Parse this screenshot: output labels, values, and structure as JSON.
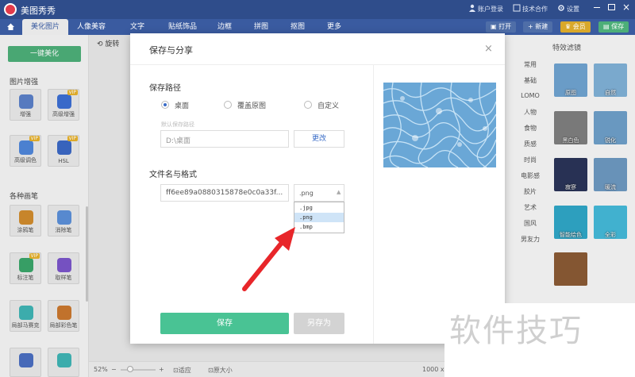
{
  "app": {
    "name": "美图秀秀"
  },
  "titlebar": {
    "account": "账户登录",
    "tech": "技术合作",
    "settings": "设置"
  },
  "tabs": [
    {
      "label": "美化图片",
      "active": true
    },
    {
      "label": "人像美容"
    },
    {
      "label": "文字"
    },
    {
      "label": "贴纸饰品"
    },
    {
      "label": "边框"
    },
    {
      "label": "拼图"
    },
    {
      "label": "抠图"
    },
    {
      "label": "更多"
    }
  ],
  "toolbar": {
    "open": "打开",
    "new": "新建",
    "crown": "会员",
    "save": "保存"
  },
  "left": {
    "one_click": "一键美化",
    "section_enhance": "图片增强",
    "section_brush": "各种画笔",
    "tools": [
      {
        "label": "增强",
        "vip": false,
        "color": "#5a7fc7"
      },
      {
        "label": "高级增强",
        "vip": true,
        "color": "#3c6ed2"
      },
      {
        "label": "高级调色",
        "vip": true,
        "color": "#4f86d9"
      },
      {
        "label": "HSL",
        "vip": false,
        "color": "#3b68c4"
      },
      {
        "label": "涂鸦笔",
        "vip": false,
        "color": "#d08b2d"
      },
      {
        "label": "消除笔",
        "vip": false,
        "color": "#5b8fd8"
      },
      {
        "label": "标注笔",
        "vip": true,
        "color": "#3aa56a"
      },
      {
        "label": "取样笔",
        "vip": false,
        "color": "#7a55c9"
      },
      {
        "label": "局部马赛克",
        "vip": false,
        "color": "#3fb3b3"
      },
      {
        "label": "局部彩色笔",
        "vip": false,
        "color": "#c9772e"
      }
    ],
    "vip_tag": "VIP"
  },
  "canvas": {
    "rotate": "旋转"
  },
  "bottom": {
    "zoom": "52%",
    "minus": "−",
    "plus": "+",
    "fit": "适应",
    "original": "原大小",
    "size": "1000 x"
  },
  "effects": {
    "title": "特效滤镜",
    "categories": [
      "常用",
      "基础",
      "LOMO",
      "人物",
      "食物",
      "质感",
      "时尚",
      "电影感",
      "胶片",
      "艺术",
      "国风",
      "男友力"
    ],
    "items": [
      {
        "label": "原图",
        "color": "#6fa3d0"
      },
      {
        "label": "自然",
        "color": "#7fb0d6"
      },
      {
        "label": "黑白色",
        "color": "#7e7e7e"
      },
      {
        "label": "锐化",
        "color": "#6e9fc8"
      },
      {
        "label": "寂寥",
        "color": "#2a3458"
      },
      {
        "label": "暖流",
        "color": "#6d98c0"
      },
      {
        "label": "智能绘色",
        "color": "#2fa6c6"
      },
      {
        "label": "全彩",
        "color": "#44b9d8"
      },
      {
        "label": "",
        "color": "#8a5a35"
      }
    ]
  },
  "dialog": {
    "title": "保存与分享",
    "close": "×",
    "path_label": "保存路径",
    "options": [
      "桌面",
      "覆盖原图",
      "自定义"
    ],
    "default_path_label": "默认保存路径",
    "path_value": "D:\\桌面",
    "change": "更改",
    "name_label": "文件名与格式",
    "filename": "ff6ee89a0880315878e0c0a33f...",
    "format": ".png",
    "formats": [
      ".jpg",
      ".png",
      ".bmp"
    ],
    "save": "保存",
    "save_as": "另存为"
  },
  "watermark": "软件技巧"
}
